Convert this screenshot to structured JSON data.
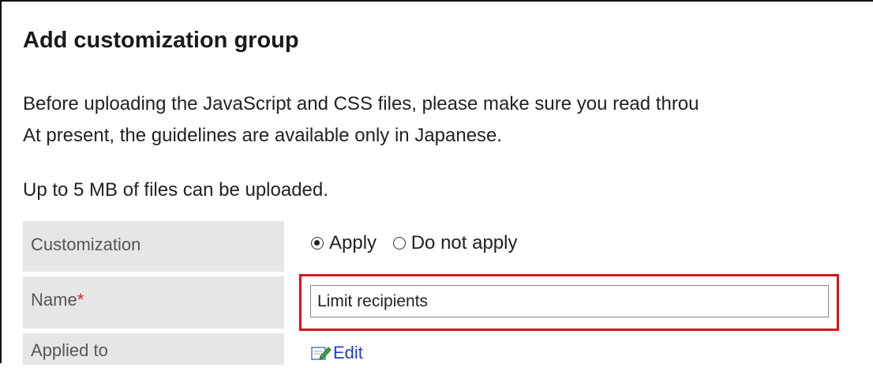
{
  "page": {
    "title": "Add customization group",
    "description_line1": "Before uploading the JavaScript and CSS files, please make sure you read throu",
    "description_line2": "At present, the guidelines are available only in Japanese.",
    "upload_limit": "Up to 5 MB of files can be uploaded."
  },
  "form": {
    "customization": {
      "label": "Customization",
      "options": [
        "Apply",
        "Do not apply"
      ],
      "selected": "Apply"
    },
    "name": {
      "label": "Name",
      "required_mark": "*",
      "value": "Limit recipients"
    },
    "applied_to": {
      "label": "Applied to",
      "link_label": "Edit"
    }
  },
  "colors": {
    "highlight": "#d6131b",
    "label_bg": "#e6e6e6",
    "link": "#1a3fd0",
    "required": "#dd2222"
  }
}
